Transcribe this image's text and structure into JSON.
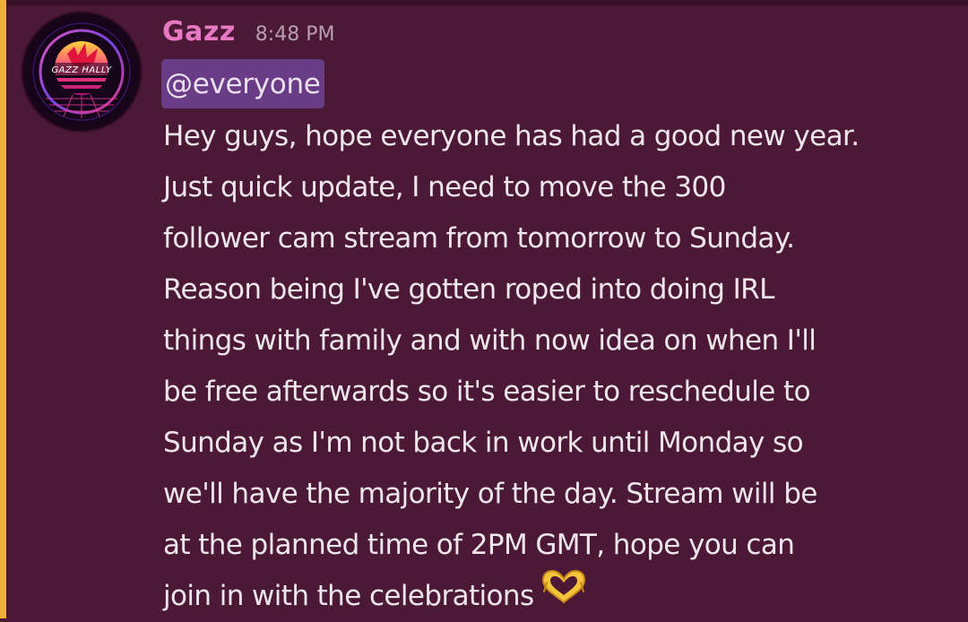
{
  "message": {
    "author": "Gazz",
    "timestamp": "8:48 PM",
    "mention": "@everyone",
    "avatar_text": "GAZZ HALLY",
    "lines": [
      "Hey guys, hope everyone has had a good new year.",
      "Just quick update, I need to move the 300",
      "follower cam stream from tomorrow to Sunday.",
      "Reason being I've gotten roped into doing IRL",
      "things with family and with now idea on when I'll",
      "be free afterwards so it's easier to reschedule to",
      "Sunday as I'm not back in work until Monday so",
      "we'll have the majority of the day. Stream will be",
      "at the planned time of 2PM GMT, hope you can",
      "join in with the celebrations"
    ],
    "trailing_emoji": "heart-hands-emoji"
  },
  "colors": {
    "background": "#4b1935",
    "mention_stripe": "#f0b132",
    "username": "#e779c4",
    "mention_pill": "#6a3b86",
    "text": "#efe6ec",
    "timestamp": "#b89fae"
  }
}
